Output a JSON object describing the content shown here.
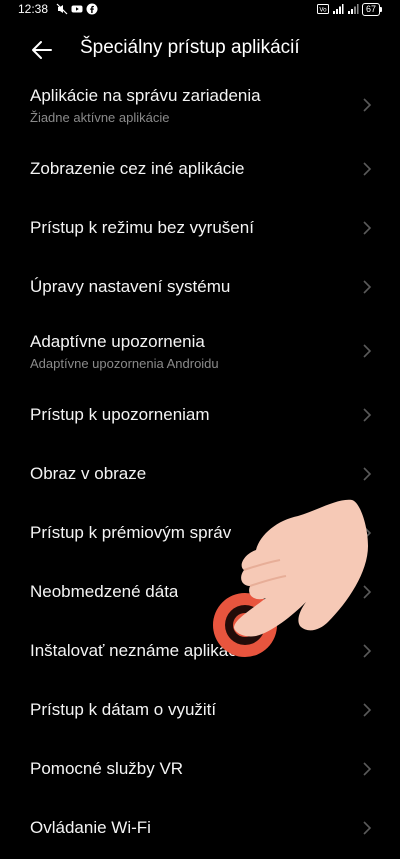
{
  "status_bar": {
    "time": "12:38",
    "battery": "67"
  },
  "header": {
    "title": "Špeciálny prístup aplikácií"
  },
  "items": [
    {
      "title": "Aplikácie na správu zariadenia",
      "subtitle": "Žiadne aktívne aplikácie"
    },
    {
      "title": "Zobrazenie cez iné aplikácie"
    },
    {
      "title": "Prístup k režimu bez vyrušení"
    },
    {
      "title": "Úpravy nastavení systému"
    },
    {
      "title": "Adaptívne upozornenia",
      "subtitle": "Adaptívne upozornenia Androidu"
    },
    {
      "title": "Prístup k upozorneniam"
    },
    {
      "title": "Obraz v obraze"
    },
    {
      "title": "Prístup k prémiovým správ"
    },
    {
      "title": "Neobmedzené dáta"
    },
    {
      "title": "Inštalovať neznáme aplikácie"
    },
    {
      "title": "Prístup k dátam o využití"
    },
    {
      "title": "Pomocné služby VR"
    },
    {
      "title": "Ovládanie Wi-Fi"
    }
  ],
  "icons": {
    "back": "arrow-left-icon",
    "chevron": "chevron-right-icon",
    "pointer": "pointing-hand-icon"
  },
  "colors": {
    "background": "#000000",
    "text": "#f4f4f4",
    "subtitle": "#8a8a8a",
    "chevron": "#5a5a5a",
    "tap_indicator": "#e8553e",
    "hand": "#f6c9b6"
  }
}
